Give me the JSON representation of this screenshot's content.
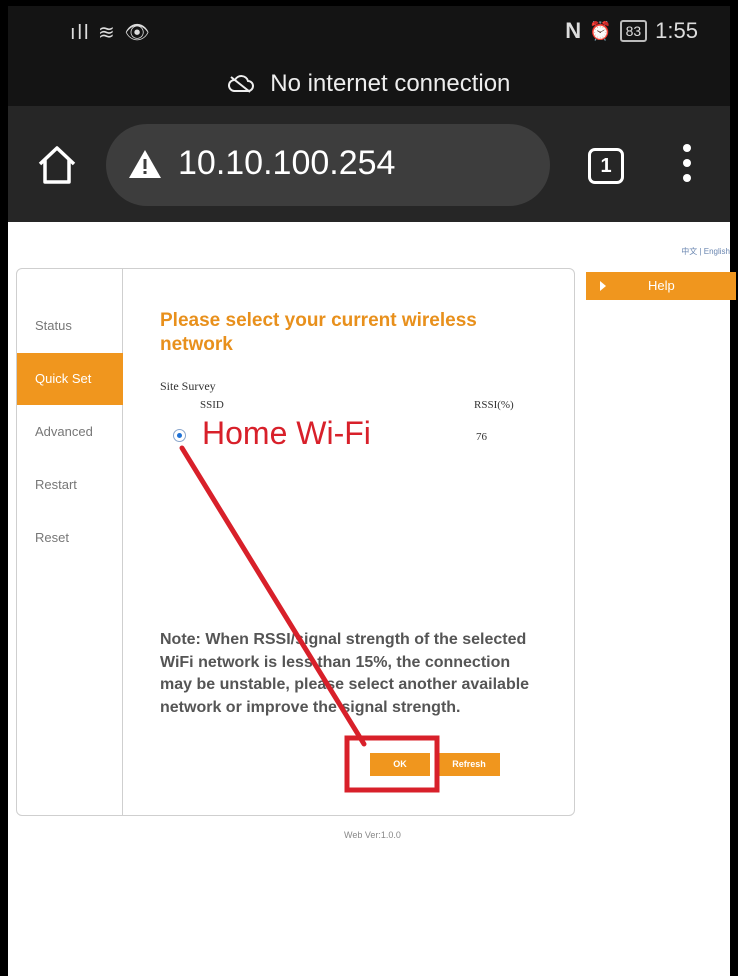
{
  "status_bar": {
    "signal_icons": "ıll ≋ 👁",
    "nfc": "N",
    "alarm": "⏰",
    "battery": "83",
    "time": "1:55"
  },
  "network_banner": {
    "icon": "cloud-off-icon",
    "text": "No internet connection"
  },
  "browser": {
    "url": "10.10.100.254",
    "tab_count": "1",
    "icons": [
      "home-icon",
      "warning-icon",
      "tabs-icon",
      "more-vert-icon"
    ]
  },
  "page": {
    "language_links": "中文 | English",
    "sidebar": {
      "items": [
        {
          "label": "Status",
          "active": false
        },
        {
          "label": "Quick Set",
          "active": true
        },
        {
          "label": "Advanced",
          "active": false
        },
        {
          "label": "Restart",
          "active": false
        },
        {
          "label": "Reset",
          "active": false
        }
      ]
    },
    "main": {
      "heading": "Please select your current wireless network",
      "site_survey_label": "Site Survey",
      "table": {
        "columns": [
          "SSID",
          "RSSI(%)"
        ],
        "rows": [
          {
            "ssid": "Home Wi-Fi",
            "rssi": "76",
            "selected": true
          }
        ]
      },
      "note": "Note: When RSSI/signal strength of the selected WiFi network is less than 15%, the connection may be unstable, please select another available network or improve the signal strength.",
      "buttons": {
        "ok": "OK",
        "refresh": "Refresh"
      }
    },
    "help": {
      "label": "Help"
    },
    "footer": {
      "web_version": "Web Ver:1.0.0"
    }
  },
  "colors": {
    "accent_orange": "#f0961e",
    "annotation_red": "#d8202a",
    "link_blue": "#6a86b0"
  }
}
